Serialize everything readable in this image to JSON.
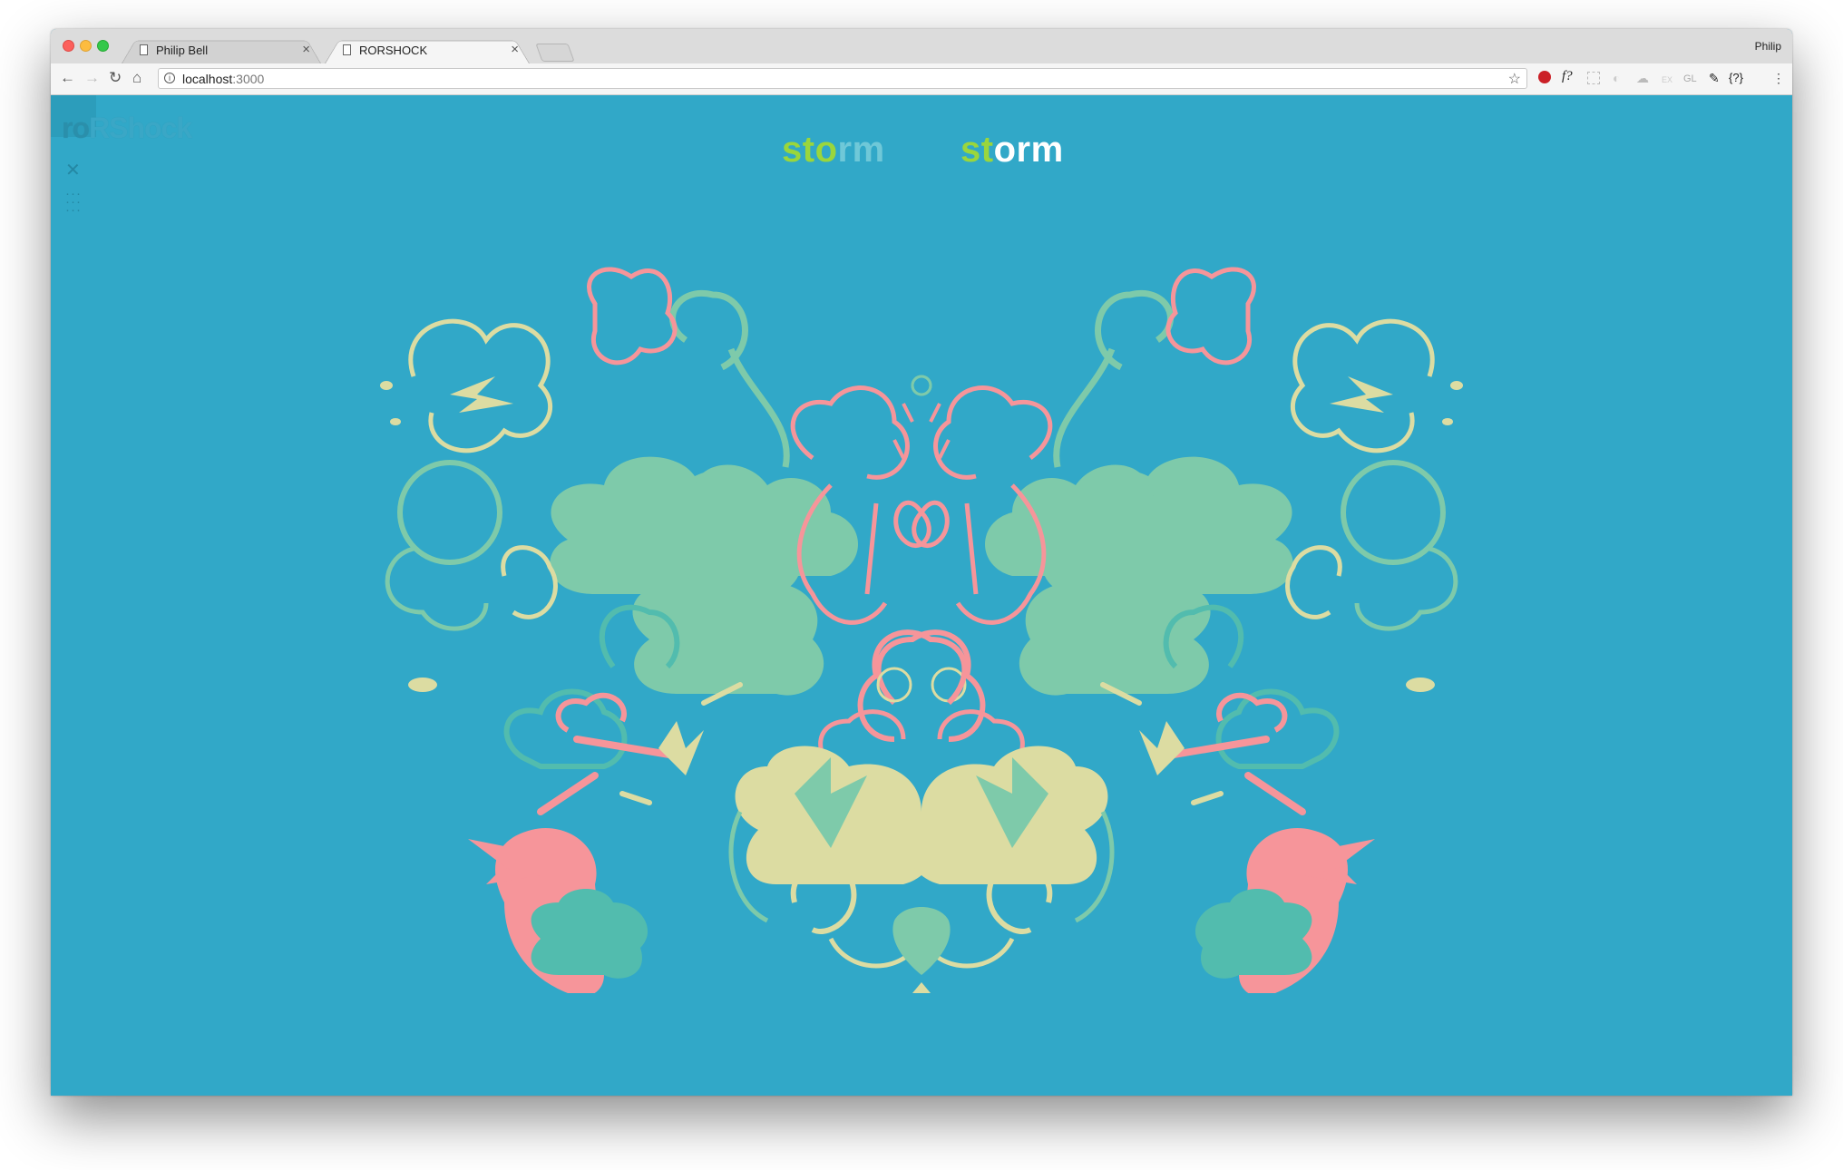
{
  "browser": {
    "tabs": [
      {
        "title": "Philip Bell",
        "active": false
      },
      {
        "title": "RORSHOCK",
        "active": true
      }
    ],
    "profile": "Philip",
    "url_host": "localhost",
    "url_port": ":3000",
    "extensions": [
      "pinterest-icon",
      "fontface-icon",
      "grid-icon",
      "puzzle-icon",
      "cloud-icon",
      "ex-icon",
      "gl-icon",
      "eyedropper-icon",
      "json-icon",
      "menu-icon"
    ],
    "extension_labels": {
      "f": "f?",
      "ex": "EX",
      "gl": "GL",
      "json": "{?}"
    }
  },
  "app": {
    "logo_left": "ro",
    "logo_right": "RShock",
    "words": [
      {
        "letters": [
          "s",
          "t",
          "o",
          "r",
          "m"
        ],
        "colors": [
          "#9ad63c",
          "#9ad63c",
          "#9ad63c",
          "#6fc8d8",
          "#6fc8d8"
        ]
      },
      {
        "letters": [
          "s",
          "t",
          "o",
          "r",
          "m"
        ],
        "colors": [
          "#9ad63c",
          "#9ad63c",
          "#ffffff",
          "#ffffff",
          "#ffffff"
        ]
      }
    ],
    "palette": {
      "background": "#31a8c8",
      "mint": "#7ecaaa",
      "teal": "#52bcae",
      "pink": "#f6959a",
      "cream": "#dcdca2",
      "lime": "#9ad63c"
    }
  }
}
